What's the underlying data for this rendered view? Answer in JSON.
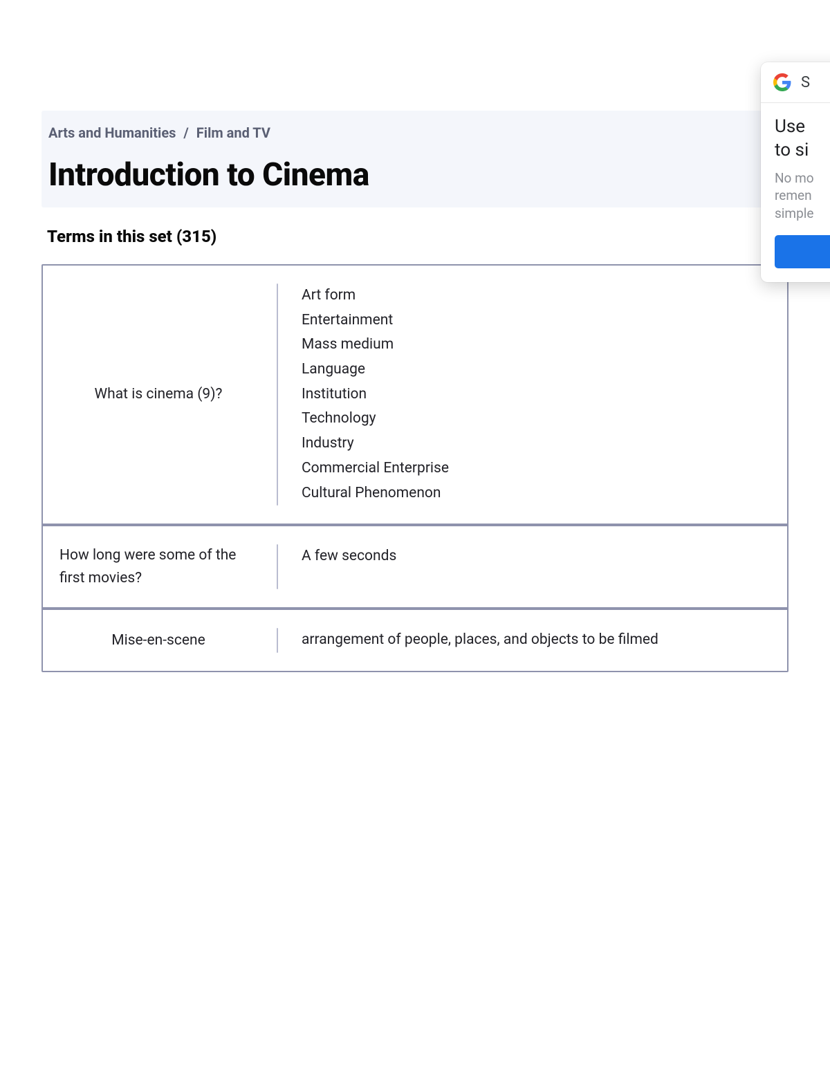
{
  "breadcrumb": {
    "parent": "Arts and Humanities",
    "separator": "/",
    "child": "Film and TV"
  },
  "page_title": "Introduction to Cinema",
  "terms_heading": "Terms in this set (315)",
  "cards": [
    {
      "term": "What is cinema (9)?",
      "definition_lines": [
        "Art form",
        "Entertainment",
        "Mass medium",
        "Language",
        "Institution",
        "Technology",
        "Industry",
        "Commercial Enterprise",
        "Cultural Phenomenon"
      ]
    },
    {
      "term": "How long were some of the first movies?",
      "definition_lines": [
        "A few seconds"
      ]
    },
    {
      "term": "Mise-en-scene",
      "definition_lines": [
        "arrangement of people, places, and objects to be filmed"
      ]
    }
  ],
  "google_popup": {
    "header_letter": "S",
    "title_line1": "Use",
    "title_line2": "to si",
    "sub_line1": "No mo",
    "sub_line2": "remen",
    "sub_line3": "simple"
  }
}
